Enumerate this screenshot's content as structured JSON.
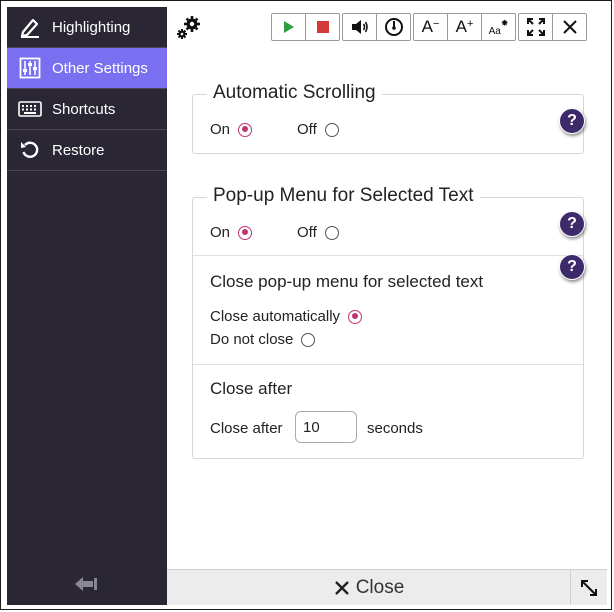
{
  "sidebar": {
    "items": [
      {
        "label": "Highlighting",
        "icon": "pen-icon"
      },
      {
        "label": "Other Settings",
        "icon": "sliders-icon"
      },
      {
        "label": "Shortcuts",
        "icon": "keyboard-icon"
      },
      {
        "label": "Restore",
        "icon": "restore-icon"
      }
    ],
    "active_index": 1,
    "active_color": "#7a6ff0",
    "background": "#2a2634"
  },
  "toolbar": {
    "play_color": "#2e9e3e",
    "stop_color": "#d23a3a",
    "font_decrease_label": "A",
    "font_increase_label": "A",
    "font_settings_label": "Aa"
  },
  "auto_scroll": {
    "title": "Automatic Scrolling",
    "on_label": "On",
    "off_label": "Off",
    "selected": "On"
  },
  "popup_menu": {
    "title": "Pop-up Menu for Selected Text",
    "on_label": "On",
    "off_label": "Off",
    "selected": "On",
    "close_section": {
      "title": "Close pop-up menu for selected text",
      "auto_label": "Close automatically",
      "never_label": "Do not close",
      "selected": "Close automatically"
    },
    "close_after": {
      "title": "Close after",
      "prefix": "Close after",
      "value": "10",
      "suffix": "seconds"
    }
  },
  "help_label": "?",
  "footer": {
    "close_label": "Close"
  },
  "accent_radio_color": "#c0356f",
  "help_color": "#3d2a6b"
}
